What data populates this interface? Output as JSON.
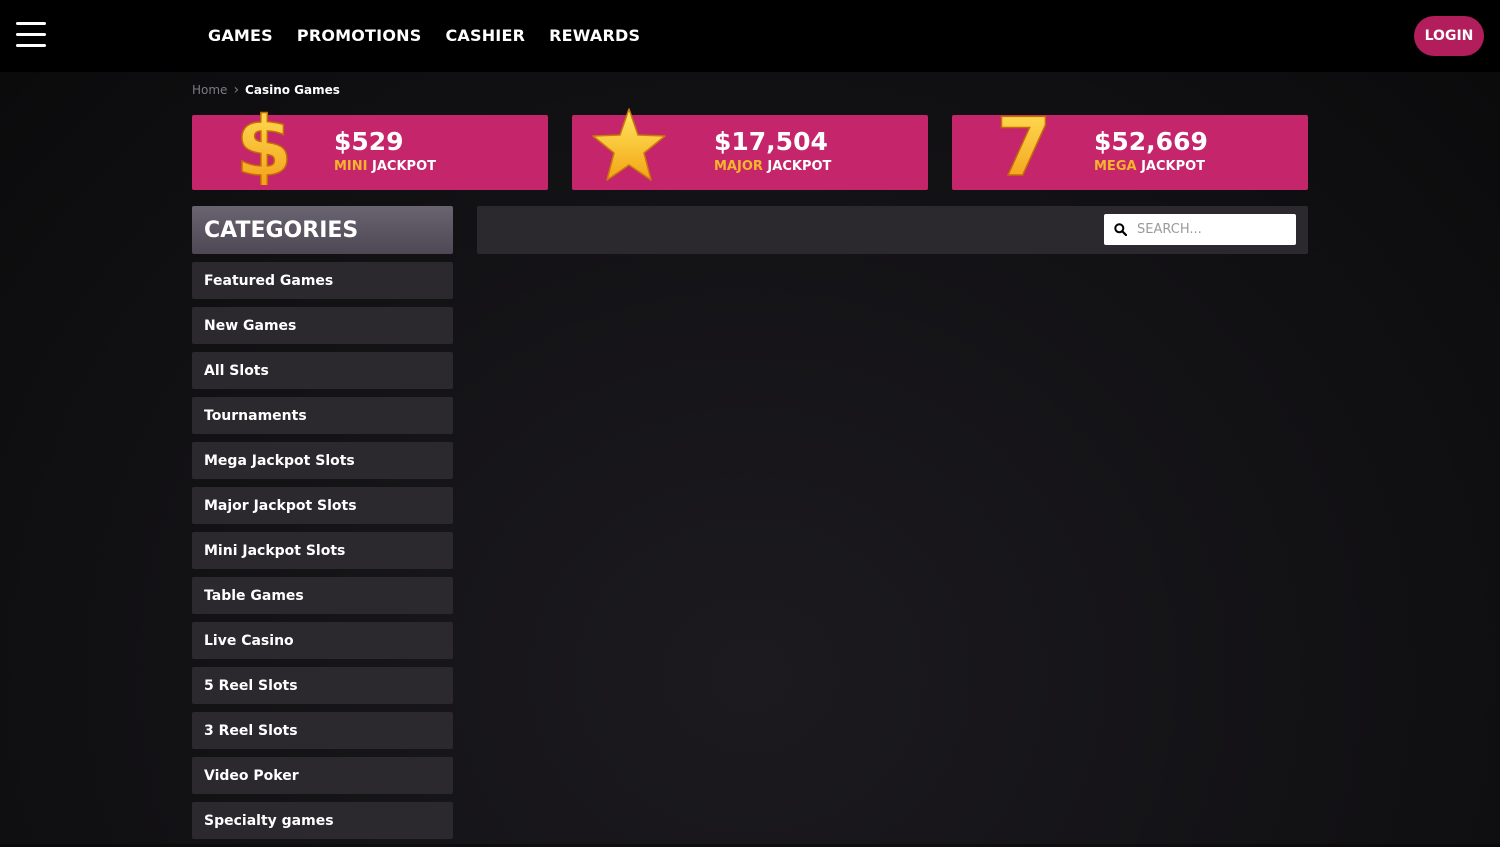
{
  "nav": {
    "items": [
      "GAMES",
      "PROMOTIONS",
      "CASHIER",
      "REWARDS"
    ],
    "login_label": "LOGIN"
  },
  "breadcrumb": {
    "home": "Home",
    "current": "Casino Games"
  },
  "jackpots": [
    {
      "amount": "$529",
      "tier": "MINI",
      "suffix": " JACKPOT",
      "icon": "dollar-icon"
    },
    {
      "amount": "$17,504",
      "tier": "MAJOR",
      "suffix": " JACKPOT",
      "icon": "star-icon"
    },
    {
      "amount": "$52,669",
      "tier": "MEGA",
      "suffix": " JACKPOT",
      "icon": "seven-icon"
    }
  ],
  "categories": {
    "title": "CATEGORIES",
    "items": [
      "Featured Games",
      "New Games",
      "All Slots",
      "Tournaments",
      "Mega Jackpot Slots",
      "Major Jackpot Slots",
      "Mini Jackpot Slots",
      "Table Games",
      "Live Casino",
      "5 Reel Slots",
      "3 Reel Slots",
      "Video Poker",
      "Specialty games"
    ]
  },
  "search": {
    "placeholder": "SEARCH..."
  },
  "colors": {
    "brand": "#c4256b",
    "accent": "#f7b52c",
    "login": "#b21e5c",
    "panel": "#2b282e"
  }
}
